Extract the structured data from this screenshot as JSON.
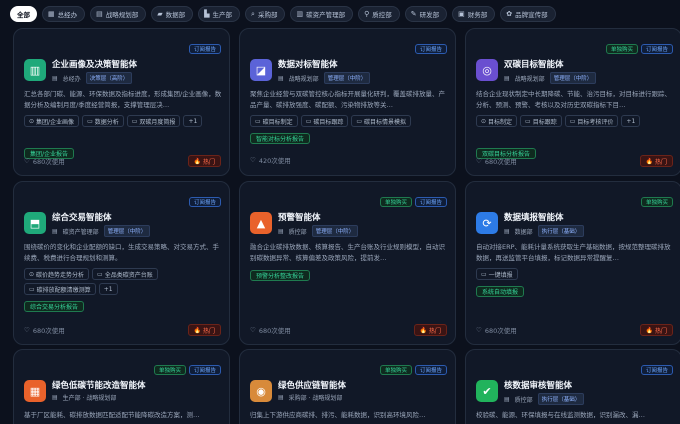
{
  "filters": [
    {
      "label": "全部",
      "icon": "",
      "active": true
    },
    {
      "label": "总经办",
      "icon": "▦"
    },
    {
      "label": "战略规划部",
      "icon": "▤"
    },
    {
      "label": "数据部",
      "icon": "▰"
    },
    {
      "label": "生产部",
      "icon": "▙"
    },
    {
      "label": "采购部",
      "icon": "⌕"
    },
    {
      "label": "碳资产管理部",
      "icon": "▥"
    },
    {
      "label": "质控部",
      "icon": "⚲"
    },
    {
      "label": "研发部",
      "icon": "✎"
    },
    {
      "label": "财务部",
      "icon": "▣"
    },
    {
      "label": "品牌宣传部",
      "icon": "✿"
    }
  ],
  "cards": [
    {
      "badges": [
        {
          "text": "订阅报告",
          "kind": "sub"
        }
      ],
      "icon_color": "#1fa97a",
      "icon_glyph": "▥",
      "icon_name": "chart-board-icon",
      "title": "企业画像及决策智能体",
      "dept": "总经办",
      "level": "决策层（高阶）",
      "desc": "汇总各部门碳、能源、环保数据及指标进度，形成集团/企业画像，数据分析及编制月度/季度经营简报，支撑管理层决…",
      "tags": [
        {
          "icon": "⊙",
          "text": "集团/企业画像"
        },
        {
          "icon": "▭",
          "text": "数据分析"
        },
        {
          "icon": "▭",
          "text": "双碳月度简报"
        },
        {
          "icon": "",
          "text": "+1"
        }
      ],
      "green_tag": "集团/企业报告",
      "uses": "680次使用",
      "hot": "热门"
    },
    {
      "badges": [
        {
          "text": "订阅报告",
          "kind": "sub"
        }
      ],
      "icon_color": "#5b63d8",
      "icon_glyph": "◪",
      "icon_name": "line-chart-icon",
      "title": "数据对标智能体",
      "dept": "战略规划部",
      "level": "管理层（中阶）",
      "desc": "聚焦企业经营与双碳管控核心指标开展量化研判，覆盖碳排放量、产品产量、碳排放强度、碳配额、污染物排放等关…",
      "tags": [
        {
          "icon": "▭",
          "text": "碳目标制定"
        },
        {
          "icon": "▭",
          "text": "碳目标跟踪"
        },
        {
          "icon": "▭",
          "text": "碳目标情景模拟"
        }
      ],
      "green_tag": "智能对标分析报告",
      "uses": "420次使用",
      "hot": ""
    },
    {
      "badges": [
        {
          "text": "单独购买",
          "kind": "one"
        },
        {
          "text": "订阅报告",
          "kind": "sub"
        }
      ],
      "icon_color": "#6a4fd0",
      "icon_glyph": "◎",
      "icon_name": "target-icon",
      "title": "双碳目标智能体",
      "dept": "战略规划部",
      "level": "管理层（中阶）",
      "desc": "结合企业现状制定中长期降碳、节能、治污目标，对目标进行跟踪、分析、预测、预警、考核以及对历史双碳指标下目…",
      "tags": [
        {
          "icon": "⊙",
          "text": "目标制定"
        },
        {
          "icon": "▭",
          "text": "目标跟踪"
        },
        {
          "icon": "▭",
          "text": "目标考核评价"
        },
        {
          "icon": "",
          "text": "+1"
        }
      ],
      "green_tag": "双碳目标分析报告",
      "uses": "680次使用",
      "hot": "热门"
    },
    {
      "badges": [
        {
          "text": "订阅报告",
          "kind": "sub"
        }
      ],
      "icon_color": "#1fa97a",
      "icon_glyph": "⬒",
      "icon_name": "trade-chart-icon",
      "title": "综合交易智能体",
      "dept": "碳资产管理部",
      "level": "管理层（中阶）",
      "desc": "围绕碳价的变化和企业配额的缺口，生成交易策略、对交易方式、手续费、税费进行合理规划和测算。",
      "tags": [
        {
          "icon": "⊙",
          "text": "碳价趋势走势分析"
        },
        {
          "icon": "▭",
          "text": "全品类碳资产台账"
        },
        {
          "icon": "▭",
          "text": "碳排放配额清缴测算"
        },
        {
          "icon": "",
          "text": "+1"
        }
      ],
      "green_tag": "综合交易分析报告",
      "uses": "680次使用",
      "hot": "热门"
    },
    {
      "badges": [
        {
          "text": "单独购买",
          "kind": "one"
        },
        {
          "text": "订阅报告",
          "kind": "sub"
        }
      ],
      "icon_color": "#e9622b",
      "icon_glyph": "▲",
      "icon_name": "warning-bell-icon",
      "title": "预警智能体",
      "dept": "质控部",
      "level": "管理层（中阶）",
      "desc": "融合企业碳排放数据、核算报告、生产台账及行业规则模型，自动识别碳数据异常、核算偏差及政策风险，提前发…",
      "tags": [],
      "green_tag": "预警分析整改报告",
      "uses": "680次使用",
      "hot": "热门"
    },
    {
      "badges": [
        {
          "text": "单独购买",
          "kind": "one"
        }
      ],
      "icon_color": "#2d7be6",
      "icon_glyph": "⟳",
      "icon_name": "sync-icon",
      "title": "数据填报智能体",
      "dept": "数据部",
      "level": "执行层（基础）",
      "desc": "自动对接ERP、能耗计量系统获取生产基础数据，按规范整理碳排放数据，再送监管平台填报，标记数据异常提醒复…",
      "tags": [
        {
          "icon": "▭",
          "text": "一键填报"
        }
      ],
      "green_tag": "系统自动填报",
      "uses": "680次使用",
      "hot": "热门"
    },
    {
      "badges": [
        {
          "text": "单独购买",
          "kind": "one"
        },
        {
          "text": "订阅报告",
          "kind": "sub"
        }
      ],
      "icon_color": "#e9622b",
      "icon_glyph": "▦",
      "icon_name": "factory-icon",
      "title": "绿色低碳节能改造智能体",
      "dept": "生产部 · 战略规划部",
      "level": "",
      "desc": "基于厂区能耗、碳排放数据匹配适配节能降碳改造方案，测…",
      "tags": [],
      "green_tag": "",
      "uses": "",
      "hot": ""
    },
    {
      "badges": [
        {
          "text": "单独购买",
          "kind": "one"
        },
        {
          "text": "订阅报告",
          "kind": "sub"
        }
      ],
      "icon_color": "#d88a3a",
      "icon_glyph": "◉",
      "icon_name": "supply-chain-icon",
      "title": "绿色供应链智能体",
      "dept": "采购部 · 战略规划部",
      "level": "",
      "desc": "归集上下游供应商碳排、排污、能耗数据，识别高环境风险…",
      "tags": [],
      "green_tag": "",
      "uses": "",
      "hot": ""
    },
    {
      "badges": [
        {
          "text": "订阅报告",
          "kind": "sub"
        }
      ],
      "icon_color": "#21b35c",
      "icon_glyph": "✔",
      "icon_name": "check-audit-icon",
      "title": "核数据审核智能体",
      "dept": "质控部",
      "level": "执行层（基础）",
      "desc": "校验碳、能源、环保填报与在线监测数据，识别漏改、漏…",
      "tags": [],
      "green_tag": "",
      "uses": "",
      "hot": ""
    }
  ]
}
